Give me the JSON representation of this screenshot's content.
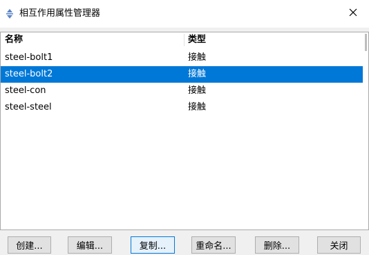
{
  "window": {
    "title": "相互作用属性管理器",
    "close_glyph": "✕"
  },
  "table": {
    "columns": [
      "名称",
      "类型"
    ],
    "rows": [
      {
        "name": "steel-bolt1",
        "type": "接触",
        "selected": false
      },
      {
        "name": "steel-bolt2",
        "type": "接触",
        "selected": true
      },
      {
        "name": "steel-con",
        "type": "接触",
        "selected": false
      },
      {
        "name": "steel-steel",
        "type": "接触",
        "selected": false
      }
    ]
  },
  "buttons": {
    "create": "创建...",
    "edit": "编辑...",
    "copy": "复制...",
    "rename": "重命名...",
    "delete": "删除...",
    "close": "关闭"
  },
  "colors": {
    "selection": "#0078d7",
    "background": "#f0f0f0",
    "list_background": "#ffffff"
  },
  "icons": {
    "title": "diamond-arrows-icon",
    "close": "close-icon"
  }
}
